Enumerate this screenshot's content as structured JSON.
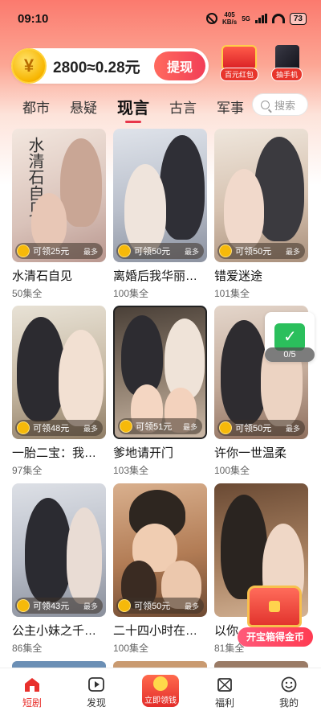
{
  "status_bar": {
    "time": "09:10",
    "speed": "405",
    "speed_unit": "KB/s",
    "network": "5G",
    "battery": "73"
  },
  "wallet": {
    "coin_symbol": "¥",
    "balance_text": "2800≈0.28元",
    "withdraw_label": "提现"
  },
  "promos": [
    {
      "label": "百元红包"
    },
    {
      "label": "抽手机"
    }
  ],
  "categories": [
    {
      "label": "都市",
      "active": false
    },
    {
      "label": "悬疑",
      "active": false
    },
    {
      "label": "现言",
      "active": true
    },
    {
      "label": "古言",
      "active": false
    },
    {
      "label": "军事",
      "active": false
    }
  ],
  "search": {
    "placeholder": "搜索"
  },
  "dramas": [
    {
      "title": "水清石自见",
      "episodes": "50集全",
      "reward": "可领25元",
      "reward_note": "最多",
      "poster_text": "水清石自见"
    },
    {
      "title": "离婚后我华丽…",
      "episodes": "100集全",
      "reward": "可领50元",
      "reward_note": "最多"
    },
    {
      "title": "错爱迷途",
      "episodes": "101集全",
      "reward": "可领50元",
      "reward_note": "最多"
    },
    {
      "title": "一胎二宝：我…",
      "episodes": "97集全",
      "reward": "可领48元",
      "reward_note": "最多"
    },
    {
      "title": "爹地请开门",
      "episodes": "103集全",
      "reward": "可领51元",
      "reward_note": "最多"
    },
    {
      "title": "许你一世温柔",
      "episodes": "100集全",
      "reward": "可领50元",
      "reward_note": "最多"
    },
    {
      "title": "公主小妹之千…",
      "episodes": "86集全",
      "reward": "可领43元",
      "reward_note": "最多"
    },
    {
      "title": "二十四小时在…",
      "episodes": "100集全",
      "reward": "可领50元",
      "reward_note": "最多"
    },
    {
      "title": "以你…",
      "episodes": "81集全",
      "reward": "",
      "reward_note": ""
    }
  ],
  "floating": {
    "task_progress": "0/5",
    "chest_label": "开宝箱得金币"
  },
  "bottom_nav": [
    {
      "label": "短剧",
      "active": true
    },
    {
      "label": "发现",
      "active": false
    },
    {
      "label": "立即领钱",
      "active": false
    },
    {
      "label": "福利",
      "active": false
    },
    {
      "label": "我的",
      "active": false
    }
  ]
}
